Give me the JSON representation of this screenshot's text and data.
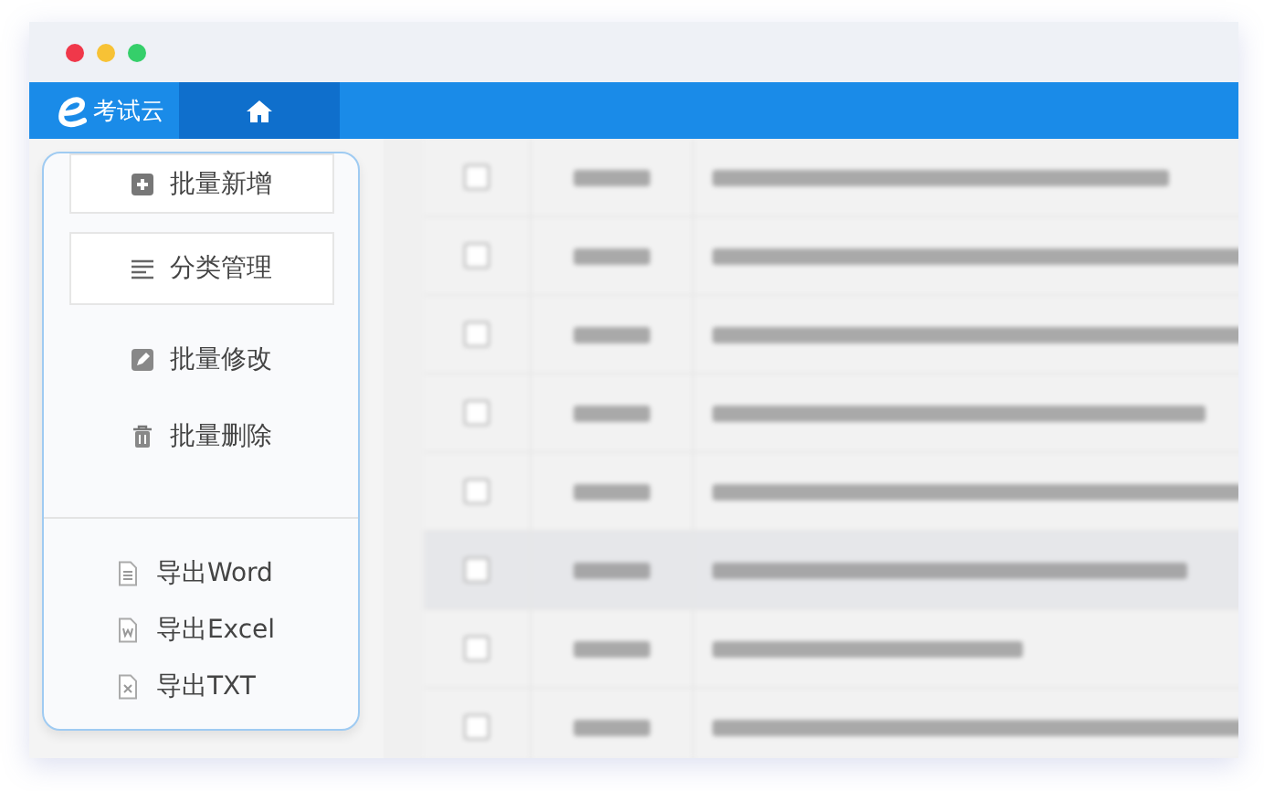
{
  "header": {
    "brand": "考试云",
    "home_tab": {
      "selected": true
    }
  },
  "menu": {
    "buttons": [
      "批量新增",
      "分类管理"
    ],
    "actions": [
      "批量修改",
      "批量删除"
    ],
    "exports": [
      "导出Word",
      "导出Excel",
      "导出TXT"
    ]
  },
  "table": {
    "rows": [
      {
        "checked": false,
        "selected": false
      },
      {
        "checked": false,
        "selected": false
      },
      {
        "checked": false,
        "selected": false
      },
      {
        "checked": false,
        "selected": false
      },
      {
        "checked": false,
        "selected": false
      },
      {
        "checked": false,
        "selected": true
      },
      {
        "checked": false,
        "selected": false
      },
      {
        "checked": false,
        "selected": false
      }
    ]
  }
}
